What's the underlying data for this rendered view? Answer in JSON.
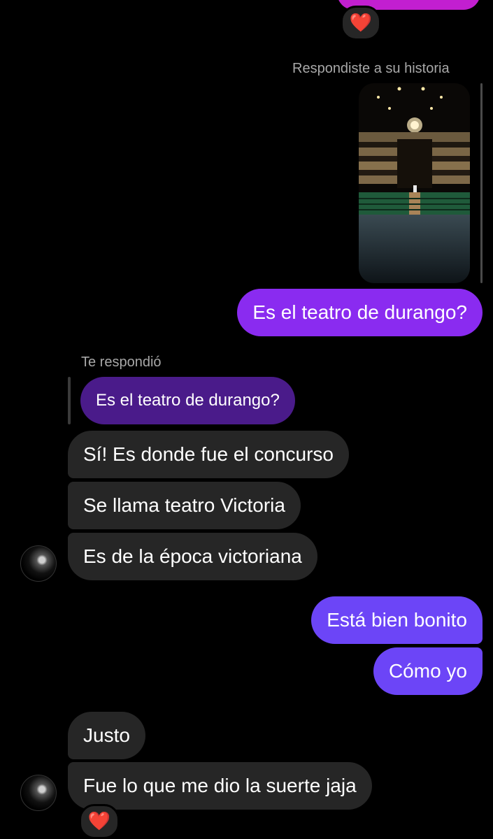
{
  "colors": {
    "background": "#000000",
    "incoming_bubble": "#262626",
    "outgoing_purple": "#8a2bf0",
    "outgoing_violet": "#6c45f7",
    "quoted_bubble": "#4a1b8a",
    "top_bubble_pink": "#c21fd0",
    "meta_text": "#a8a8a8"
  },
  "top_reaction": {
    "emoji": "❤️"
  },
  "story_reply": {
    "label": "Respondiste a su historia",
    "image_icon": "theater-interior-photo"
  },
  "messages": [
    {
      "text": "Es el teatro de durango?"
    }
  ],
  "reply": {
    "label": "Te respondió",
    "quoted": "Es el teatro de durango?"
  },
  "incoming_group1": [
    {
      "text": "Sí! Es donde fue el concurso"
    },
    {
      "text": "Se llama teatro Victoria"
    },
    {
      "text": "Es de la época victoriana"
    }
  ],
  "outgoing_group2": [
    {
      "text": "Está bien bonito"
    },
    {
      "text": "Cómo yo"
    }
  ],
  "incoming_group2": [
    {
      "text": "Justo"
    },
    {
      "text": "Fue lo que me dio la suerte jaja"
    }
  ],
  "bottom_reaction": {
    "emoji": "❤️"
  }
}
